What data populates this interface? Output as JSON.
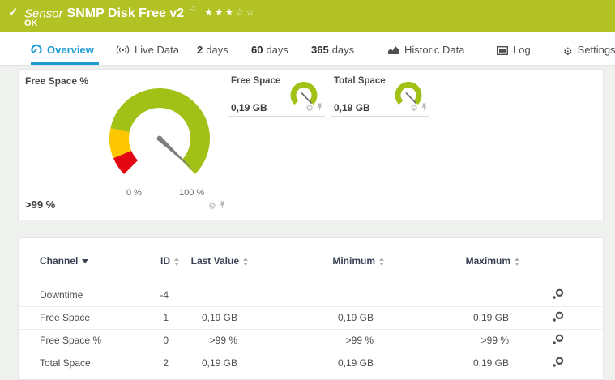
{
  "colors": {
    "brand_green": "#b2c225",
    "accent_blue": "#1e9cd2",
    "gauge_green": "#a2c117",
    "gauge_yellow": "#fcc700",
    "gauge_red": "#e30613"
  },
  "header": {
    "type_label": "Sensor",
    "title": "SNMP Disk Free v2",
    "status": "OK",
    "stars_filled": 3,
    "stars_total": 5
  },
  "tabs": [
    {
      "label": "Overview",
      "active": true
    },
    {
      "label": "Live Data"
    },
    {
      "number": "2",
      "label": "days"
    },
    {
      "number": "60",
      "label": "days"
    },
    {
      "number": "365",
      "label": "days"
    },
    {
      "label": "Historic Data"
    },
    {
      "label": "Log"
    },
    {
      "label": "Settings"
    }
  ],
  "chart_data": [
    {
      "type": "gauge",
      "title": "Free Space %",
      "value_label": ">99 %",
      "value_percent": 99.5,
      "scale": {
        "min": 0,
        "max": 100,
        "min_label": "0 %",
        "max_label": "100 %"
      },
      "sweep_degrees": 270,
      "segments": [
        {
          "color": "#e30613",
          "from": 0,
          "to": 9
        },
        {
          "color": "#fcc700",
          "from": 9,
          "to": 22
        },
        {
          "color": "#a2c117",
          "from": 22,
          "to": 100
        }
      ]
    },
    {
      "type": "gauge",
      "title": "Free Space",
      "value_label": "0,19 GB",
      "color": "#a2c117"
    },
    {
      "type": "gauge",
      "title": "Total Space",
      "value_label": "0,19 GB",
      "color": "#a2c117"
    }
  ],
  "table": {
    "columns": [
      {
        "label": "Channel",
        "sorted": true
      },
      {
        "label": "ID"
      },
      {
        "label": "Last Value"
      },
      {
        "label": "Minimum"
      },
      {
        "label": "Maximum"
      }
    ],
    "rows": [
      {
        "channel": "Downtime",
        "id": "-4",
        "last_value": "",
        "minimum": "",
        "maximum": ""
      },
      {
        "channel": "Free Space",
        "id": "1",
        "last_value": "0,19 GB",
        "minimum": "0,19 GB",
        "maximum": "0,19 GB"
      },
      {
        "channel": "Free Space %",
        "id": "0",
        "last_value": ">99 %",
        "minimum": ">99 %",
        "maximum": ">99 %"
      },
      {
        "channel": "Total Space",
        "id": "2",
        "last_value": "0,19 GB",
        "minimum": "0,19 GB",
        "maximum": "0,19 GB"
      }
    ]
  }
}
